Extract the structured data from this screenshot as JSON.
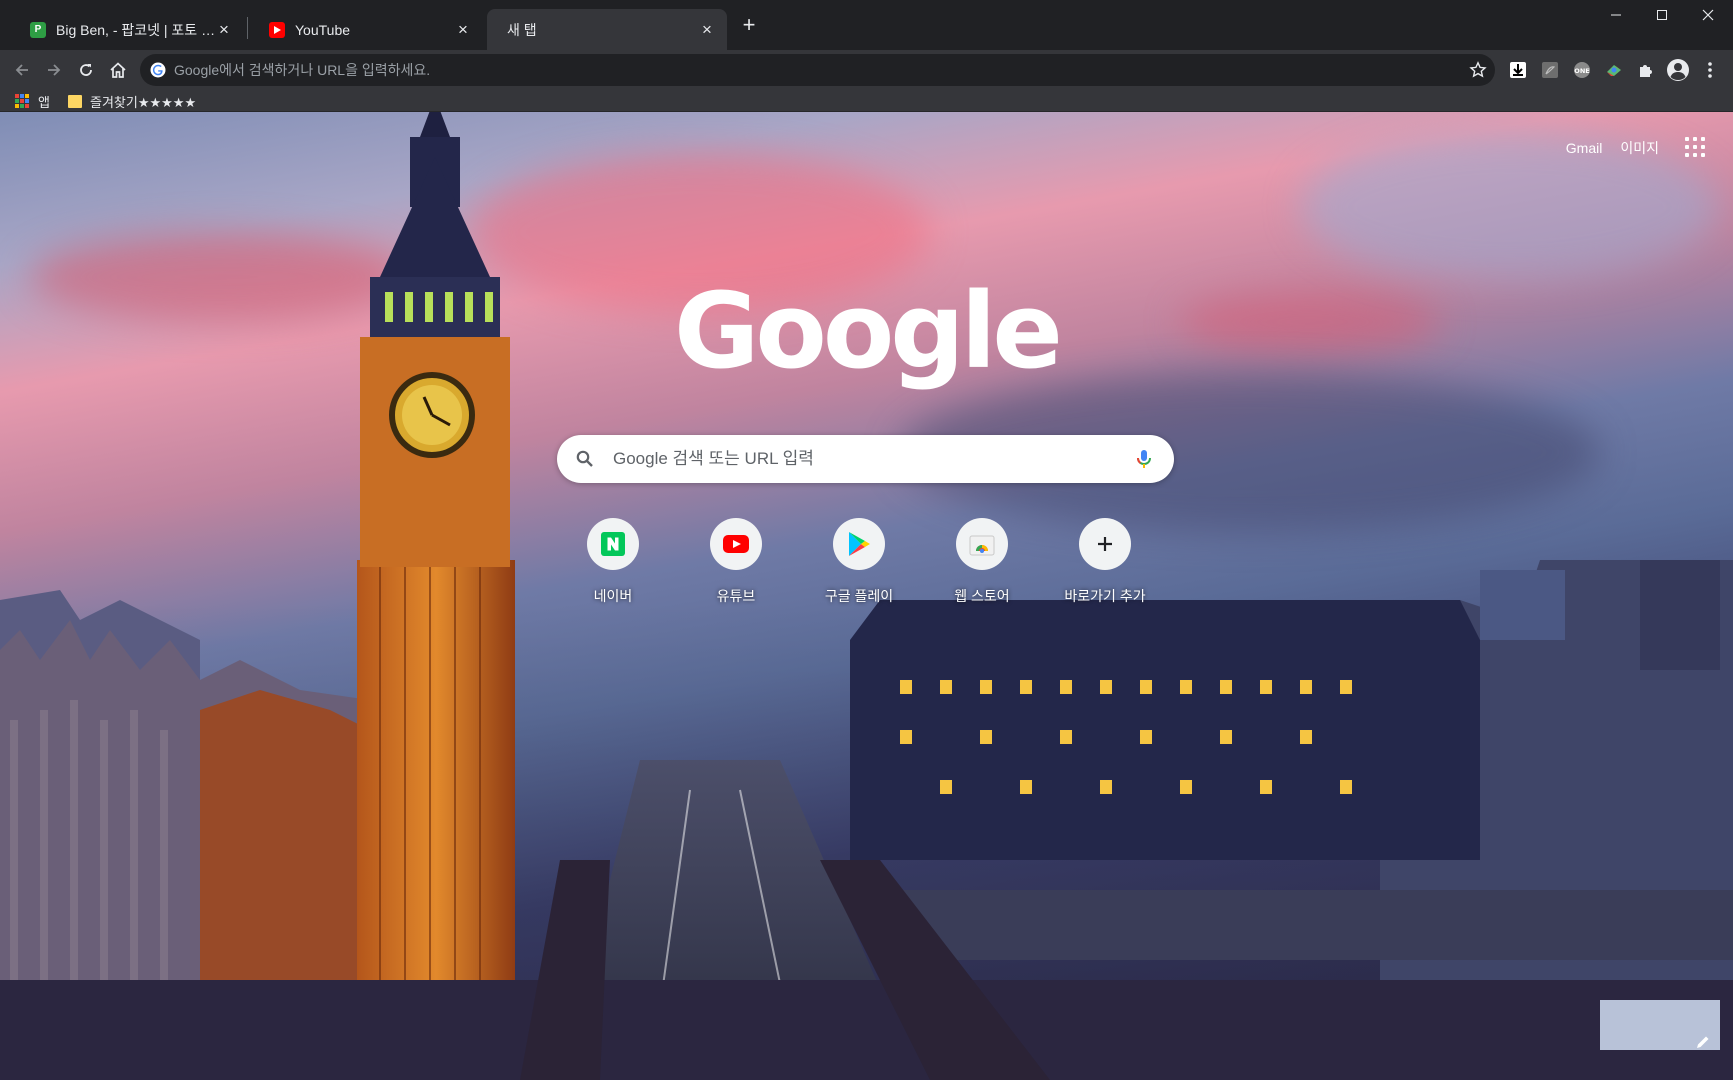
{
  "tabs": [
    {
      "title": "Big Ben, - 팝코넷 | 포토 갤러리",
      "favicon": "popco-icon",
      "active": false
    },
    {
      "title": "YouTube",
      "favicon": "youtube-icon",
      "active": false
    },
    {
      "title": "새 탭",
      "favicon": "",
      "active": true
    }
  ],
  "newtab_label": "+",
  "omnibox": {
    "placeholder": "Google에서 검색하거나 URL을 입력하세요."
  },
  "bookmarks": [
    {
      "label": "앱",
      "icon": "apps-icon"
    },
    {
      "label": "즐겨찾기★★★★★",
      "icon": "folder-icon"
    }
  ],
  "ntp": {
    "top_links": [
      "Gmail",
      "이미지"
    ],
    "logo_text": "Google",
    "search_placeholder": "Google 검색 또는 URL 입력",
    "shortcuts": [
      {
        "label": "네이버",
        "icon": "naver-icon"
      },
      {
        "label": "유튜브",
        "icon": "youtube-icon"
      },
      {
        "label": "구글 플레이",
        "icon": "google-play-icon"
      },
      {
        "label": "웹 스토어",
        "icon": "web-store-icon"
      },
      {
        "label": "바로가기 추가",
        "icon": "add-icon"
      }
    ]
  },
  "colors": {
    "frame": "#202124",
    "toolbar": "#35363a",
    "naver": "#03c75a",
    "youtube": "#ff0000",
    "bigben_gold": "#d9822b"
  }
}
